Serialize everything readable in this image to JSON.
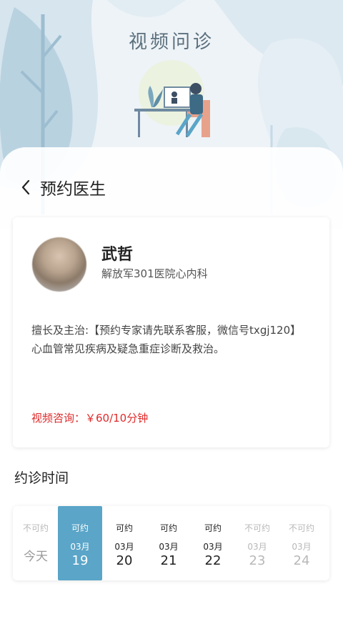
{
  "header": {
    "title": "视频问诊"
  },
  "nav": {
    "back_icon": "chevron-left-icon",
    "title": "预约医生"
  },
  "doctor": {
    "name": "武哲",
    "hospital": "解放军301医院心内科",
    "specialty": "擅长及主治:【预约专家请先联系客服，微信号txgj120】心血管常见疾病及疑急重症诊断及救治。",
    "price": "视频咨询：￥60/10分钟"
  },
  "appointment": {
    "title": "约诊时间",
    "days": [
      {
        "status": "不可约",
        "label": "今天",
        "month": "",
        "date": "",
        "state": "off"
      },
      {
        "status": "可约",
        "label": "",
        "month": "03月",
        "date": "19",
        "state": "selected"
      },
      {
        "status": "可约",
        "label": "",
        "month": "03月",
        "date": "20",
        "state": "on"
      },
      {
        "status": "可约",
        "label": "",
        "month": "03月",
        "date": "21",
        "state": "on"
      },
      {
        "status": "可约",
        "label": "",
        "month": "03月",
        "date": "22",
        "state": "on"
      },
      {
        "status": "不可约",
        "label": "",
        "month": "03月",
        "date": "23",
        "state": "off"
      },
      {
        "status": "不可约",
        "label": "",
        "month": "03月",
        "date": "24",
        "state": "off"
      }
    ]
  },
  "colors": {
    "accent": "#5aa5c8",
    "price": "#e02a2a",
    "disabled": "#b8b8b8"
  }
}
